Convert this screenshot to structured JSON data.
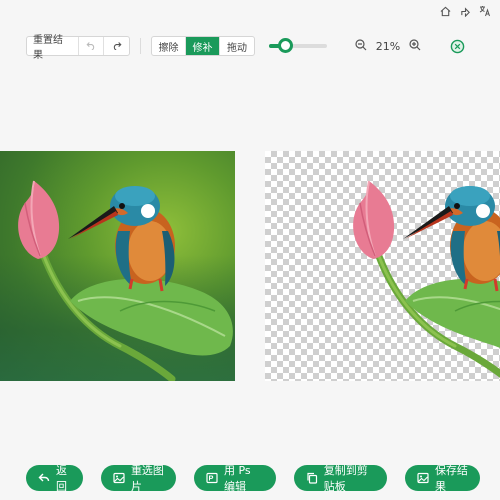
{
  "top_icons": [
    "home-icon",
    "share-icon",
    "translate-icon"
  ],
  "toolbar": {
    "reset_label": "重置结果",
    "undo_icon": "undo-icon",
    "redo_icon": "redo-icon",
    "modes": [
      {
        "label": "擦除",
        "active": false
      },
      {
        "label": "修补",
        "active": true
      },
      {
        "label": "拖动",
        "active": false
      }
    ],
    "brush_size_fraction": 0.2,
    "zoom_out_icon": "zoom-out-icon",
    "zoom_value": "21%",
    "zoom_in_icon": "zoom-in-icon",
    "compare_icon": "compare-icon"
  },
  "actions": [
    {
      "label": "返回",
      "icon": "back-icon"
    },
    {
      "label": "重选图片",
      "icon": "image-icon"
    },
    {
      "label": "用 Ps 编辑",
      "icon": "ps-icon"
    },
    {
      "label": "复制到剪贴板",
      "icon": "copy-icon"
    },
    {
      "label": "保存结果",
      "icon": "save-icon"
    }
  ],
  "colors": {
    "accent": "#1a9a5a"
  }
}
